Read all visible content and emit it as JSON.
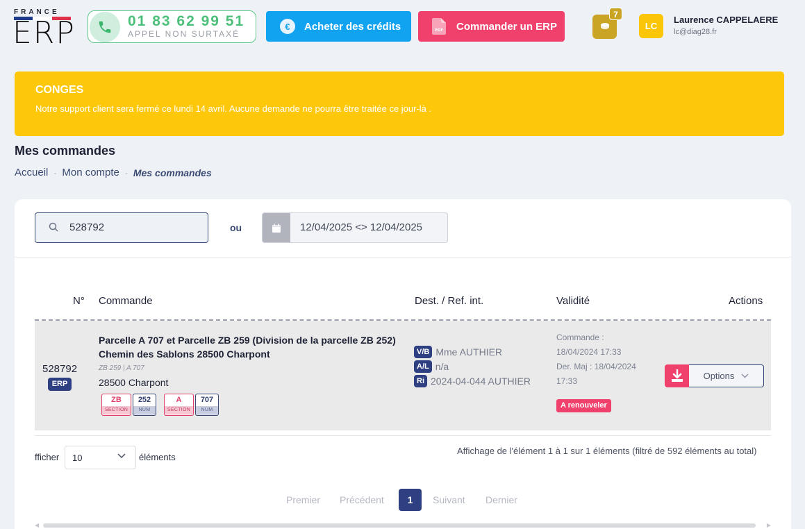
{
  "logo": {
    "top": "FRANCE",
    "big": "ERP",
    "flag_colors": [
      "#1e3a8a",
      "#ffffff",
      "#e0314b"
    ]
  },
  "header": {
    "phone_number": "01 83 62 99 51",
    "phone_sub": "APPEL NON SURTAXÉ",
    "credits_label": "Acheter des crédits",
    "credits_icon": "€",
    "order_erp_label": "Commander un ERP",
    "pdf_icon_label": "PDF",
    "coins_count": "7",
    "user_initials": "LC",
    "user_name": "Laurence CAPPELAERE",
    "user_email": "lc@diag28.fr"
  },
  "banner": {
    "title": "CONGES",
    "message": "Notre support client sera fermé ce lundi 14 avril. Aucune demande ne pourra être traitée ce jour-là ."
  },
  "page": {
    "title": "Mes commandes",
    "breadcrumb": [
      "Accueil",
      "Mon compte",
      "Mes commandes"
    ],
    "breadcrumb_sep": "-"
  },
  "filters": {
    "search_value": "528792",
    "or_label": "ou",
    "date_range": "12/04/2025 <> 12/04/2025"
  },
  "table": {
    "headers": {
      "num": "N°",
      "commande": "Commande",
      "dest": "Dest. / Ref. int.",
      "validite": "Validité",
      "actions": "Actions"
    },
    "row": {
      "number": "528792",
      "type_badge": "ERP",
      "title_line1": "Parcelle A 707 et Parcelle ZB 259 (Division de la parcelle ZB 252)",
      "title_line2": "Chemin des Sablons 28500 Charpont",
      "sub": "ZB 259 | A 707",
      "city": "28500 Charpont",
      "parcels": [
        {
          "section": "ZB",
          "section_label": "SECTION",
          "num": "252",
          "num_label": "NUM"
        },
        {
          "section": "A",
          "section_label": "SECTION",
          "num": "707",
          "num_label": "NUM"
        }
      ],
      "dest": [
        {
          "tag": "V/B",
          "value": "Mme AUTHIER"
        },
        {
          "tag": "A/L",
          "value": "n/a"
        },
        {
          "tag": "Ri",
          "value": "2024-04-044 AUTHIER"
        }
      ],
      "validity": {
        "commande_label": "Commande :",
        "commande_date": "18/04/2024 17:33",
        "maj_line": "Der. Maj : 18/04/2024",
        "maj_time": "17:33",
        "status": "A renouveler"
      },
      "options_label": "Options"
    }
  },
  "footer": {
    "show_label": "fficher",
    "page_size": "10",
    "elements_label": "éléments",
    "info": "Affichage de l'élément 1 à 1 sur 1 éléments (filtré de 592 éléments au total)",
    "pagination": {
      "first": "Premier",
      "prev": "Précédent",
      "current": "1",
      "next": "Suivant",
      "last": "Dernier"
    }
  },
  "colors": {
    "accent_blue": "#2e3f82",
    "pink": "#f0416d",
    "banner_yellow": "#fec80a",
    "cta_blue": "#12a3f0",
    "green": "#4cc07a"
  }
}
